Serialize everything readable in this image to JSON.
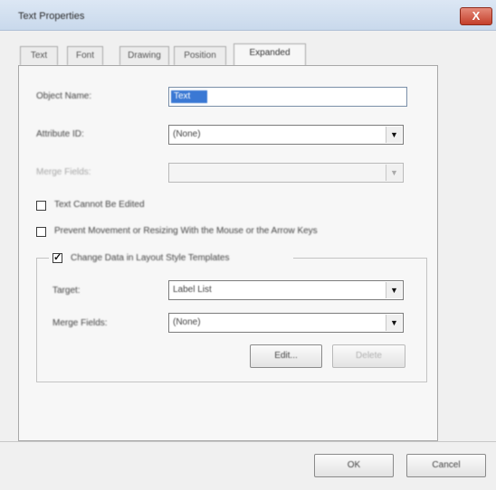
{
  "window": {
    "title": "Text Properties",
    "close_glyph": "X"
  },
  "tabs": [
    {
      "label": "Text",
      "active": false
    },
    {
      "label": "Font",
      "active": false
    },
    {
      "label": "Drawing",
      "active": false
    },
    {
      "label": "Position",
      "active": false
    },
    {
      "label": "Expanded",
      "active": true
    }
  ],
  "expanded": {
    "object_name": {
      "label": "Object Name:",
      "value": "Text"
    },
    "attribute_id": {
      "label": "Attribute ID:",
      "value": "(None)"
    },
    "merge_fields": {
      "label": "Merge Fields:",
      "value": ""
    },
    "text_cannot_be_edited": {
      "label": "Text Cannot Be Edited",
      "checked": false
    },
    "prevent_movement": {
      "label": "Prevent Movement or Resizing With the Mouse or the Arrow Keys",
      "checked": false
    },
    "group": {
      "label": "Change Data in Layout Style Templates",
      "checked": true,
      "check_glyph": "✓",
      "target": {
        "label": "Target:",
        "value": "Label List"
      },
      "merge_fields": {
        "label": "Merge Fields:",
        "value": "(None)"
      },
      "edit_button": "Edit...",
      "delete_button": "Delete"
    }
  },
  "footer": {
    "ok_button": "OK",
    "cancel_button": "Cancel"
  },
  "icons": {
    "dropdown_arrow": "▼"
  }
}
